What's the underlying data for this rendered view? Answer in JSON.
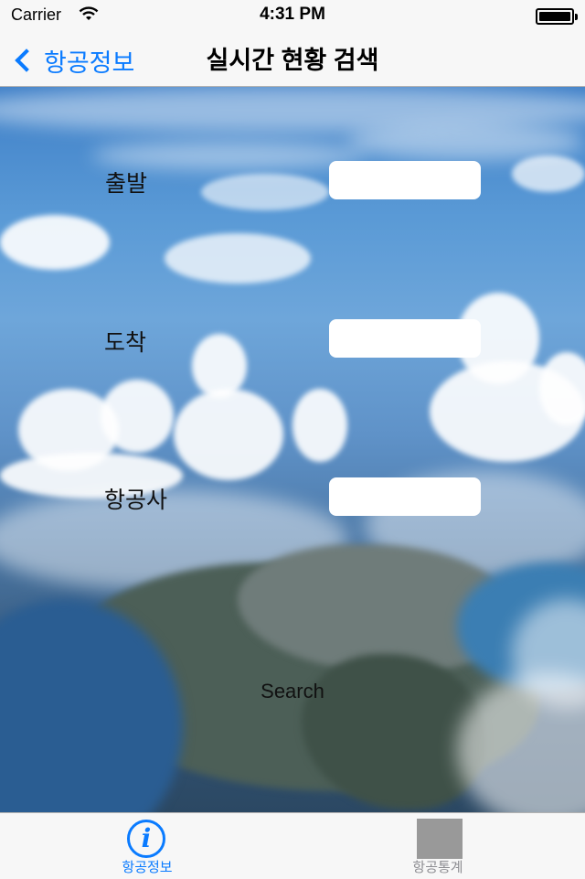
{
  "status_bar": {
    "carrier": "Carrier",
    "time": "4:31 PM"
  },
  "nav": {
    "back_label": "항공정보",
    "title": "실시간 현황 검색"
  },
  "form": {
    "departure_label": "출발",
    "departure_value": "",
    "arrival_label": "도착",
    "arrival_value": "",
    "airline_label": "항공사",
    "airline_value": "",
    "search_label": "Search"
  },
  "tabs": [
    {
      "label": "항공정보",
      "icon": "info-icon",
      "selected": true
    },
    {
      "label": "항공통계",
      "icon": "stats-placeholder-icon",
      "selected": false
    }
  ],
  "colors": {
    "accent": "#0a7bff",
    "tab_inactive": "#8e8e93"
  }
}
